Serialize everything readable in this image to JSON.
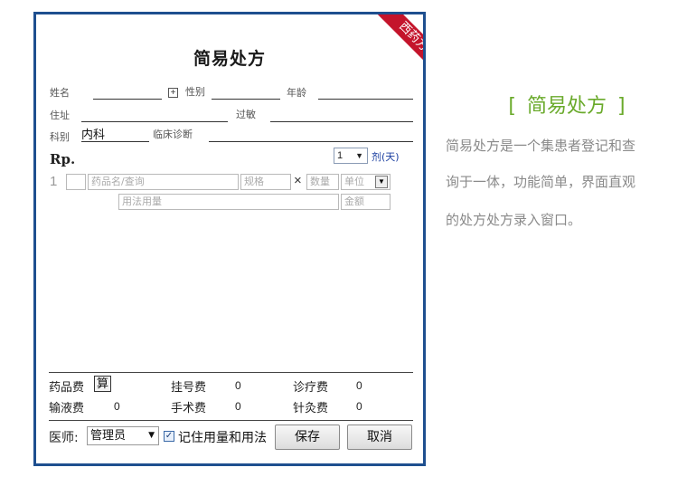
{
  "form": {
    "ribbon": "西药方",
    "title": "简易处方",
    "fields": {
      "name_label": "姓名",
      "name_value": "",
      "gender_label": "性别",
      "gender_value": "",
      "age_label": "年龄",
      "age_value": "",
      "address_label": "住址",
      "address_value": "",
      "allergy_label": "过敏",
      "allergy_value": "",
      "dept_label": "科别",
      "dept_value": "内科",
      "diagnosis_label": "临床诊断",
      "diagnosis_value": ""
    },
    "rp_label": "Rp.",
    "dose_count": "1",
    "dose_unit": "剂(天)",
    "row": {
      "index": "1",
      "drug_placeholder": "药品名/查询",
      "spec_placeholder": "规格",
      "times": "×",
      "qty_placeholder": "数量",
      "unit_placeholder": "单位",
      "usage_placeholder": "用法用量",
      "amount_placeholder": "金额"
    },
    "fees": {
      "drug_label": "药品费",
      "calc_button": "算",
      "register_label": "挂号费",
      "register_value": "0",
      "treatment_label": "诊疗费",
      "treatment_value": "0",
      "infusion_label": "输液费",
      "infusion_value": "0",
      "surgery_label": "手术费",
      "surgery_value": "0",
      "acupuncture_label": "针灸费",
      "acupuncture_value": "0"
    },
    "footer": {
      "doctor_label": "医师:",
      "doctor_value": "管理员",
      "remember_label": "记住用量和用法",
      "remember_checked": true,
      "save_button": "保存",
      "cancel_button": "取消"
    }
  },
  "description": {
    "title": "简易处方",
    "lines": [
      "简易处方是一个集患者登记和查",
      "询于一体，功能简单，界面直观",
      "的处方处方录入窗口。"
    ]
  },
  "colors": {
    "frame_border": "#1e4f8f",
    "ribbon": "#c4142b",
    "title_accent": "#6aaa2b",
    "description_text": "#8a8a8a"
  }
}
